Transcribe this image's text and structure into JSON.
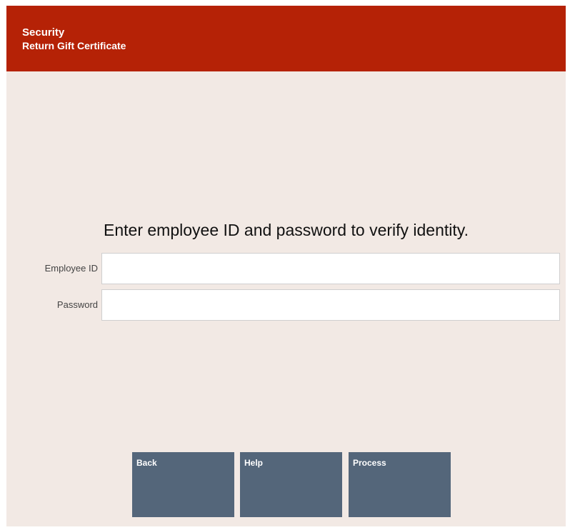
{
  "header": {
    "title": "Security",
    "subtitle": "Return Gift Certificate"
  },
  "main": {
    "prompt": "Enter employee ID and password to verify identity.",
    "fields": {
      "employee_id": {
        "label": "Employee ID",
        "value": "",
        "placeholder": ""
      },
      "password": {
        "label": "Password",
        "value": "",
        "placeholder": ""
      }
    }
  },
  "buttons": {
    "back": "Back",
    "help": "Help",
    "process": "Process"
  },
  "colors": {
    "header_bg": "#b52206",
    "body_bg": "#f2e9e4",
    "button_bg": "#54667a"
  }
}
